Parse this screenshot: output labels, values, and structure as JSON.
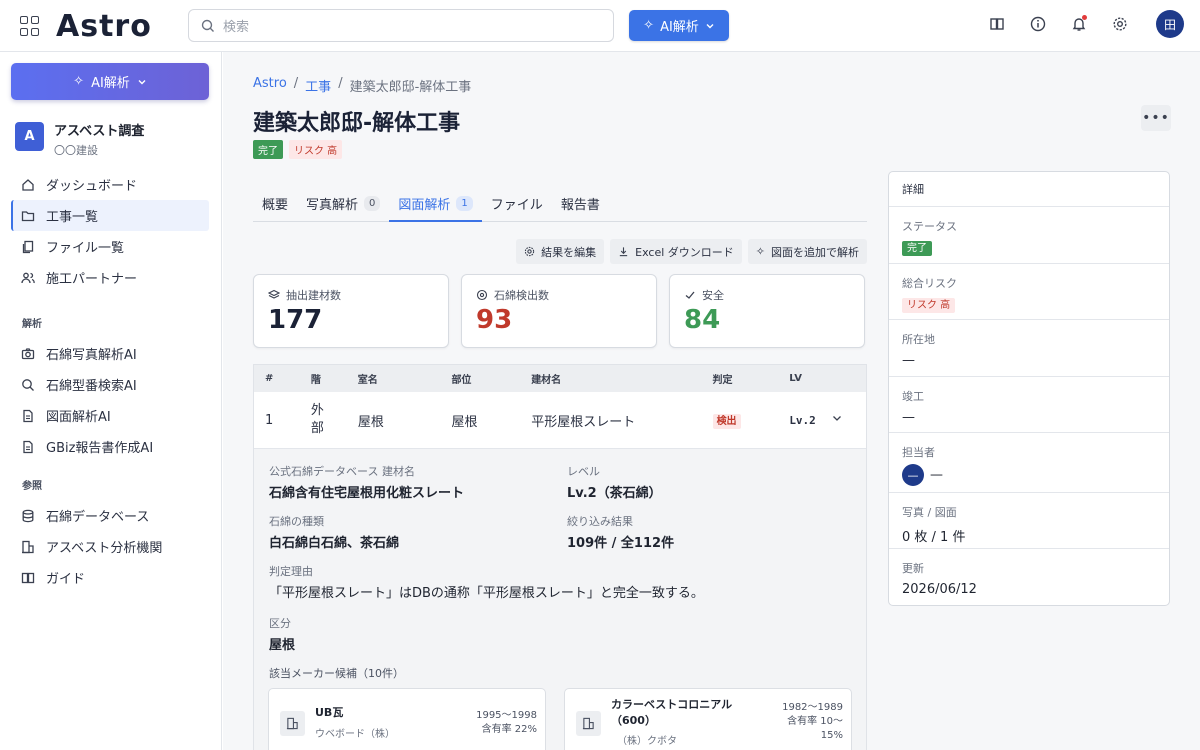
{
  "app": {
    "logo": "Astro"
  },
  "header": {
    "search_placeholder": "検索",
    "ai_button": "AI解析",
    "avatar_initial": "田"
  },
  "sidebar": {
    "ai_button": "AI解析",
    "org": {
      "badge": "A",
      "name": "アスベスト調査",
      "sub": "〇〇建設"
    },
    "main_items": [
      {
        "label": "ダッシュボード",
        "icon": "home-icon"
      },
      {
        "label": "工事一覧",
        "icon": "folder-icon",
        "active": true
      },
      {
        "label": "ファイル一覧",
        "icon": "files-icon"
      },
      {
        "label": "施工パートナー",
        "icon": "users-icon"
      }
    ],
    "section_analysis": "解析",
    "analysis_items": [
      {
        "label": "石綿写真解析AI",
        "icon": "camera-icon"
      },
      {
        "label": "石綿型番検索AI",
        "icon": "search-icon"
      },
      {
        "label": "図面解析AI",
        "icon": "document-icon"
      },
      {
        "label": "GBiz報告書作成AI",
        "icon": "document-icon"
      }
    ],
    "section_reference": "参照",
    "reference_items": [
      {
        "label": "石綿データベース",
        "icon": "database-icon"
      },
      {
        "label": "アスベスト分析機関",
        "icon": "building-icon"
      },
      {
        "label": "ガイド",
        "icon": "book-icon"
      }
    ]
  },
  "breadcrumb": {
    "root": "Astro",
    "section": "工事",
    "current": "建築太郎邸-解体工事",
    "sep": "/"
  },
  "page": {
    "title": "建築太郎邸-解体工事",
    "status_badge": "完了",
    "risk_badge": "リスク 高",
    "more": "•••"
  },
  "tabs": [
    {
      "label": "概要"
    },
    {
      "label": "写真解析",
      "count": "0"
    },
    {
      "label": "図面解析",
      "count": "1",
      "active": true
    },
    {
      "label": "ファイル"
    },
    {
      "label": "報告書"
    }
  ],
  "actions": {
    "edit": "結果を編集",
    "excel": "Excel ダウンロード",
    "add": "図面を追加で解析"
  },
  "stats": [
    {
      "label": "抽出建材数",
      "value": "177",
      "color": "#1b2236"
    },
    {
      "label": "石綿検出数",
      "value": "93",
      "color": "#c0392b"
    },
    {
      "label": "安全",
      "value": "84",
      "color": "#3d9a56"
    }
  ],
  "table": {
    "headers": [
      "#",
      "階",
      "室名",
      "部位",
      "建材名",
      "判定",
      "LV"
    ],
    "row": {
      "num": "1",
      "floor": "外部",
      "room": "屋根",
      "part": "屋根",
      "material": "平形屋根スレート",
      "result": "検出",
      "lv": "Lv.2"
    }
  },
  "detail": {
    "db_label": "公式石綿データベース 建材名",
    "db_value": "石綿含有住宅屋根用化粧スレート",
    "level_label": "レベル",
    "level_value": "Lv.2（茶石綿）",
    "type_label": "石綿の種類",
    "type_value": "白石綿白石綿、茶石綿",
    "filter_label": "絞り込み結果",
    "filter_value": "109件 / 全112件",
    "reason_label": "判定理由",
    "reason_value": "「平形屋根スレート」はDBの通称「平形屋根スレート」と完全一致する。",
    "category_label": "区分",
    "category_value": "屋根",
    "makers_label": "該当メーカー候補（10件）",
    "makers": [
      {
        "name": "UB瓦",
        "company": "ウベボード（株）",
        "years": "1995〜1998",
        "rate": "含有率 22%"
      },
      {
        "name": "カラーベストコロニアル（600）",
        "company": "（株）クボタ",
        "years": "1982〜1989",
        "rate": "含有率 10〜15%"
      }
    ]
  },
  "panel": {
    "title": "詳細",
    "status_label": "ステータス",
    "status_value": "完了",
    "risk_label": "総合リスク",
    "risk_value": "リスク 高",
    "location_label": "所在地",
    "location_value": "—",
    "completion_label": "竣工",
    "completion_value": "—",
    "owner_label": "担当者",
    "owner_avatar": "—",
    "owner_value": "—",
    "photos_label": "写真 / 図面",
    "photos_value": "0 枚 / 1 件",
    "updated_label": "更新",
    "updated_value": "2026/06/12"
  }
}
